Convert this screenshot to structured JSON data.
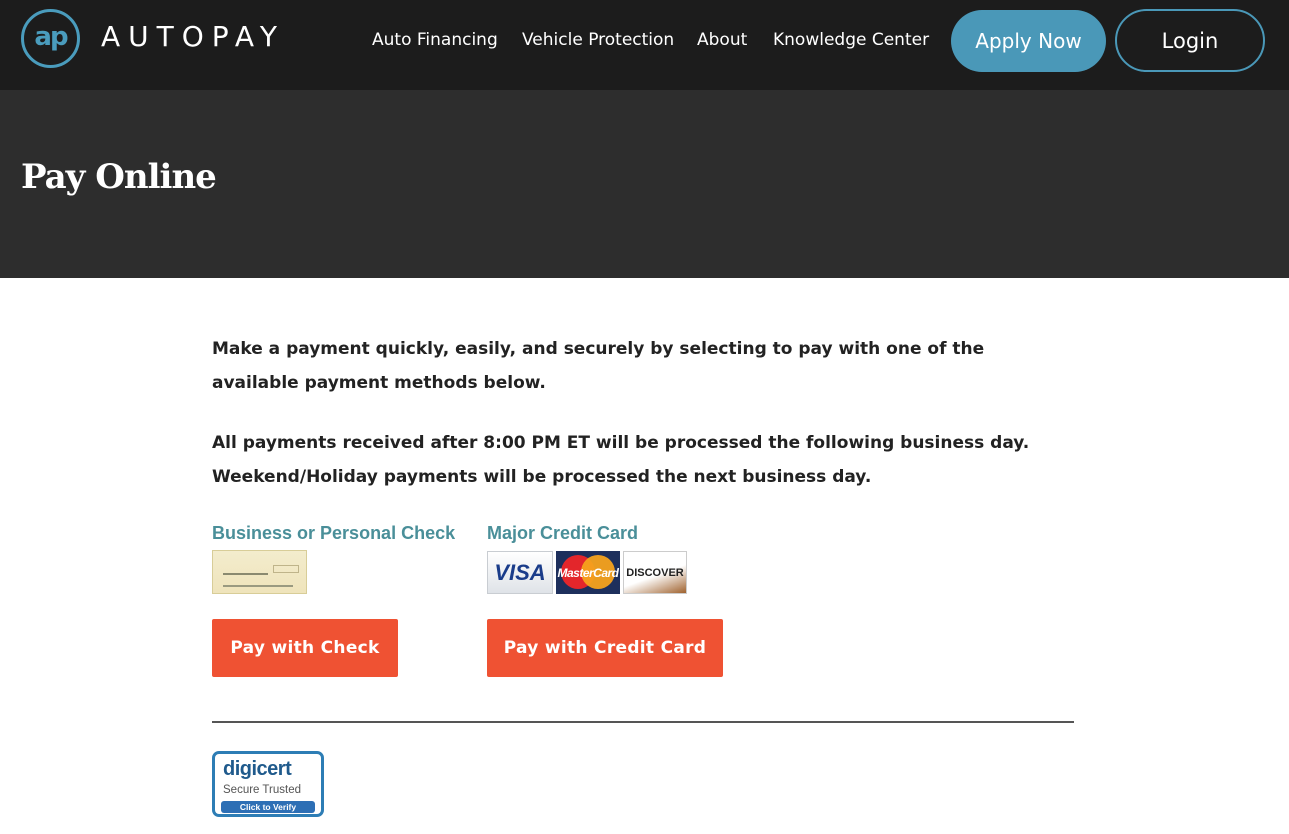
{
  "header": {
    "logo_mark": "ap",
    "logo_text": "AUTOPAY",
    "nav": [
      "Auto Financing",
      "Vehicle Protection",
      "About",
      "Knowledge Center"
    ],
    "apply_label": "Apply Now",
    "login_label": "Login"
  },
  "hero": {
    "title": "Pay Online"
  },
  "main": {
    "intro": "Make a payment quickly, easily, and securely by selecting to pay with one of the available payment methods below.",
    "notice": "All payments received after 8:00 PM ET will be processed the following business day. Weekend/Holiday payments will be processed the next business day.",
    "methods": [
      {
        "label": "Business or Personal Check",
        "button": "Pay with Check"
      },
      {
        "label": "Major Credit Card",
        "button": "Pay with Credit Card"
      }
    ],
    "cards": [
      "VISA",
      "MasterCard",
      "DISCOVER"
    ]
  },
  "trust": {
    "name": "digicert",
    "subtitle": "Secure  Trusted",
    "verify": "Click to Verify"
  },
  "colors": {
    "header_bg": "#1c1c1c",
    "hero_bg": "#2d2d2d",
    "accent_blue": "#4a98b8",
    "cta_orange": "#ef5233",
    "method_label": "#4a8f99"
  }
}
